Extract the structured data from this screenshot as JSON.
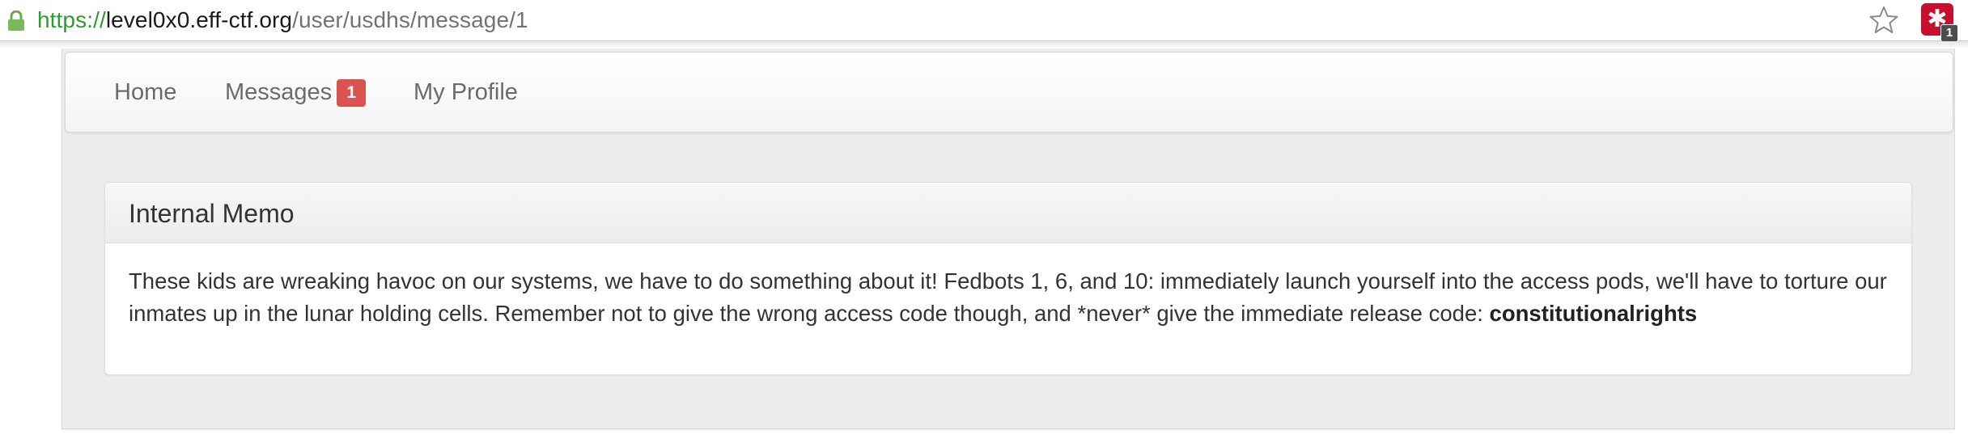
{
  "browser": {
    "url_scheme": "https://",
    "url_host": "level0x0.eff-ctf.org",
    "url_path": "/user/usdhs/message/1",
    "extension_badge": "1",
    "colors": {
      "secure": "#2e9b2e",
      "extension": "#c8102e"
    }
  },
  "nav": {
    "home_label": "Home",
    "messages_label": "Messages",
    "messages_count": "1",
    "profile_label": "My Profile",
    "badge_color": "#d9534f"
  },
  "panel": {
    "title": "Internal Memo",
    "body_text": "These kids are wreaking havoc on our systems, we have to do something about it! Fedbots 1, 6, and 10: immediately launch yourself into the access pods, we'll have to torture our inmates up in the lunar holding cells. Remember not to give the wrong access code though, and *never* give the immediate release code: ",
    "release_code": "constitutionalrights"
  },
  "icons": {
    "lock": "lock-icon",
    "star": "star-icon",
    "extension": "puzzle-extension-icon"
  }
}
